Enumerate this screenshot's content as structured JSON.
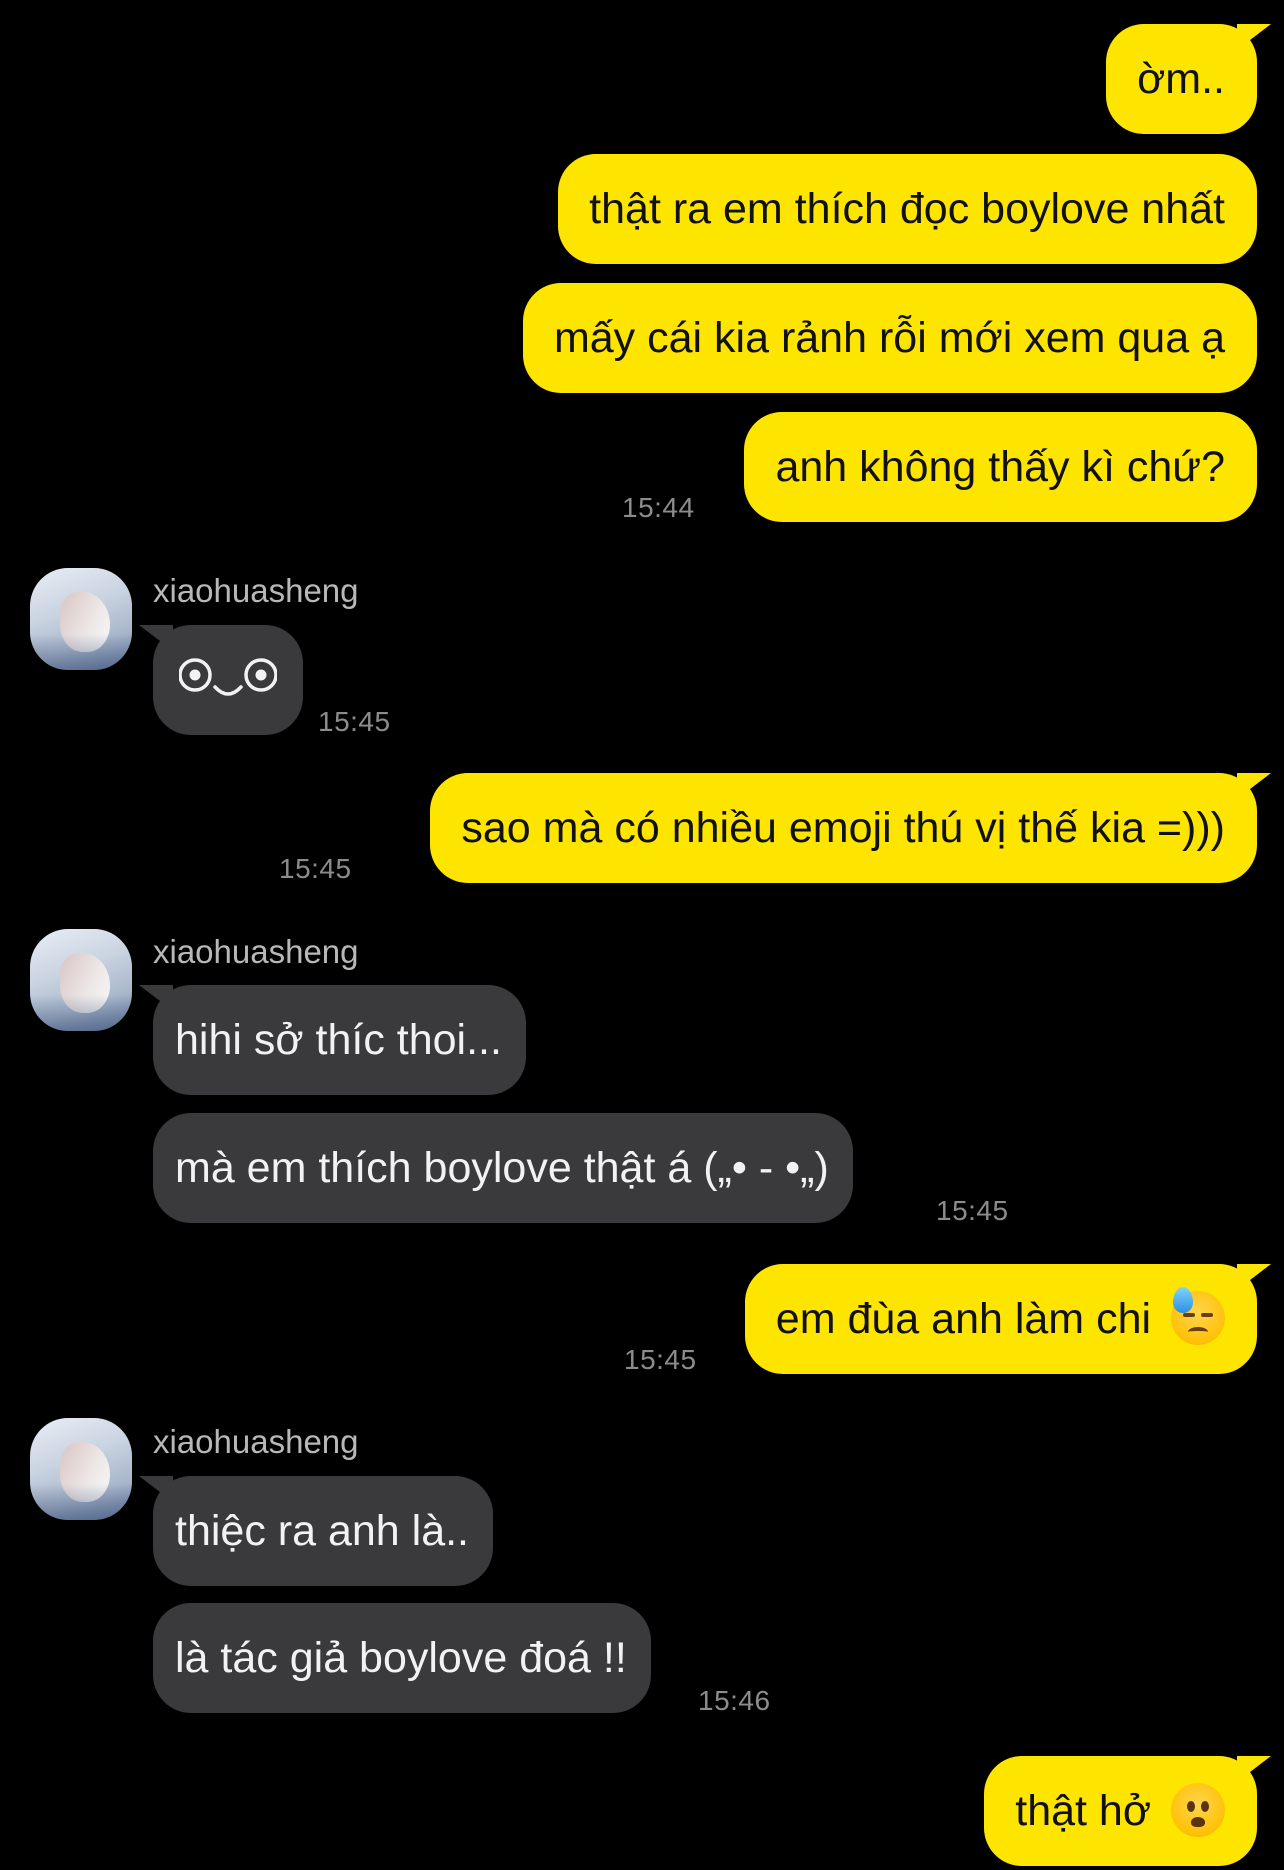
{
  "messages": [
    {
      "side": "me",
      "text": "ờm.."
    },
    {
      "side": "me",
      "text": "thật ra em thích đọc boylove nhất"
    },
    {
      "side": "me",
      "text": "mấy cái kia rảnh rỗi mới xem qua ạ"
    },
    {
      "side": "me",
      "text": "anh không thấy kì chứ?",
      "time": "15:44"
    },
    {
      "side": "them",
      "sender": "xiaohuasheng",
      "kaomoji_icon": "smiling-kaomoji-icon",
      "time": "15:45"
    },
    {
      "side": "me",
      "text": "sao mà có nhiều emoji thú vị thế kia =)))",
      "time": "15:45"
    },
    {
      "side": "them",
      "sender": "xiaohuasheng",
      "text": "hihi sở thíc thoi..."
    },
    {
      "side": "them",
      "text": "mà em thích boylove thật á („• - •„)",
      "time": "15:45"
    },
    {
      "side": "me",
      "text": "em đùa anh làm chi",
      "emoji_icon": "downcast-sweat-face-icon",
      "time": "15:45"
    },
    {
      "side": "them",
      "sender": "xiaohuasheng",
      "text": "thiệc ra anh là.."
    },
    {
      "side": "them",
      "text": "là tác giả boylove đoá !!",
      "time": "15:46"
    },
    {
      "side": "me",
      "text": "thật hở",
      "emoji_icon": "frowning-open-mouth-face-icon"
    }
  ],
  "colors": {
    "background": "#000000",
    "my_bubble": "#fee500",
    "their_bubble": "#3a3a3c",
    "timestamp": "#8c8c8c"
  }
}
